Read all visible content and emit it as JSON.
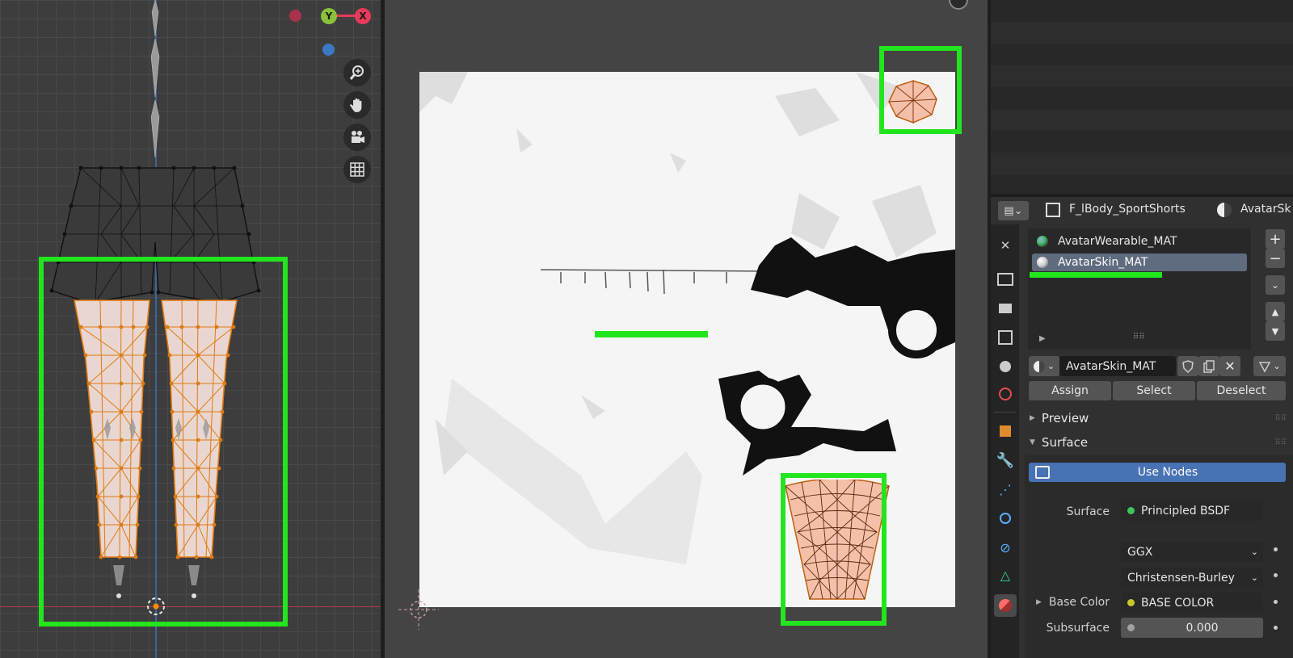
{
  "gizmo": {
    "y_label": "Y",
    "x_label": "X"
  },
  "colors": {
    "accent_green": "#22e51e",
    "selected_blue": "#4772b3",
    "x_axis": "#e83a5a",
    "y_axis": "#8bc23b",
    "z_axis": "#3c78c3"
  },
  "viewport_tools": [
    "zoom-icon",
    "hand-pan-icon",
    "camera-icon",
    "grid-icon"
  ],
  "properties": {
    "object_name": "F_lBody_SportShorts",
    "material_header": "AvatarSk",
    "material_slots": [
      {
        "name": "AvatarWearable_MAT",
        "selected": false
      },
      {
        "name": "AvatarSkin_MAT",
        "selected": true
      }
    ],
    "active_material": "AvatarSkin_MAT",
    "buttons": {
      "assign": "Assign",
      "select": "Select",
      "deselect": "Deselect"
    },
    "panels": {
      "preview": "Preview",
      "surface": "Surface"
    },
    "use_nodes": "Use Nodes",
    "surface_label": "Surface",
    "surface_value": "Principled BSDF",
    "distribution": "GGX",
    "subsurface_method": "Christensen-Burley",
    "base_color_label": "Base Color",
    "base_color_value": "BASE COLOR",
    "subsurface_label": "Subsurface",
    "subsurface_value": "0.000"
  }
}
